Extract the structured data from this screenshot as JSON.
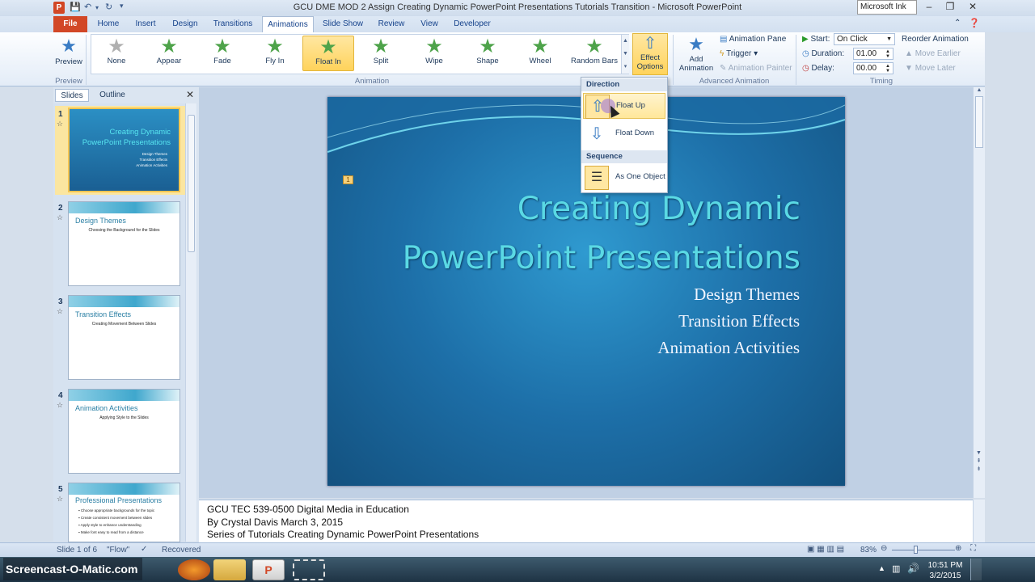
{
  "window": {
    "title": "GCU DME MOD 2 Assign Creating Dynamic PowerPoint Presentations Tutorials Transition  -  Microsoft PowerPoint",
    "ink_label": "Microsoft Ink",
    "app_letter": "P"
  },
  "tabs": [
    "File",
    "Home",
    "Insert",
    "Design",
    "Transitions",
    "Animations",
    "Slide Show",
    "Review",
    "View",
    "Developer"
  ],
  "ribbon": {
    "preview": {
      "label": "Preview",
      "group": "Preview"
    },
    "animations": [
      "None",
      "Appear",
      "Fade",
      "Fly In",
      "Float In",
      "Split",
      "Wipe",
      "Shape",
      "Wheel",
      "Random Bars"
    ],
    "animation_group": "Animation",
    "effect_options": [
      "Effect",
      "Options"
    ],
    "add_animation": [
      "Add",
      "Animation"
    ],
    "advanced": {
      "animation_pane": "Animation Pane",
      "trigger": "Trigger",
      "animation_painter": "Animation Painter",
      "group": "Advanced Animation"
    },
    "timing": {
      "start_label": "Start:",
      "start_value": "On Click",
      "duration_label": "Duration:",
      "duration_value": "01.00",
      "delay_label": "Delay:",
      "delay_value": "00.00",
      "reorder": "Reorder Animation",
      "move_earlier": "Move Earlier",
      "move_later": "Move Later",
      "group": "Timing"
    }
  },
  "dropdown": {
    "direction_header": "Direction",
    "float_up": "Float Up",
    "float_down": "Float Down",
    "sequence_header": "Sequence",
    "as_one_object": "As One Object"
  },
  "pane": {
    "slides_tab": "Slides",
    "outline_tab": "Outline"
  },
  "thumbnails": [
    {
      "num": "1",
      "title": "Creating Dynamic PowerPoint Presentations",
      "lines": [
        "Design Themes",
        "Transition Effects",
        "Animation Activities"
      ]
    },
    {
      "num": "2",
      "title": "Design Themes",
      "sub": "Choosing the Background for the Slides"
    },
    {
      "num": "3",
      "title": "Transition Effects",
      "sub": "Creating Movement Between Slides"
    },
    {
      "num": "4",
      "title": "Animation Activities",
      "sub": "Applying Style to the Slides"
    },
    {
      "num": "5",
      "title": "Professional Presentations",
      "bullets": [
        "Choose appropriate backgrounds for the topic",
        "Create consistent movement between slides",
        "Apply style to enhance understanding",
        "Make font easy to read from a distance"
      ]
    }
  ],
  "slide": {
    "title_line1": "Creating Dynamic",
    "title_line2": "PowerPoint Presentations",
    "subtitles": [
      "Design Themes",
      "Transition Effects",
      "Animation Activities"
    ],
    "anim_marker": "1"
  },
  "notes": [
    "GCU TEC 539-0500  Digital Media in Education",
    "By Crystal Davis  March 3, 2015",
    "Series of Tutorials Creating Dynamic PowerPoint Presentations"
  ],
  "status": {
    "slide": "Slide 1 of 6",
    "theme": "\"Flow\"",
    "recovered": "Recovered",
    "zoom": "83%"
  },
  "taskbar": {
    "watermark": "Screencast-O-Matic.com",
    "time": "10:51 PM",
    "date": "3/2/2015"
  }
}
